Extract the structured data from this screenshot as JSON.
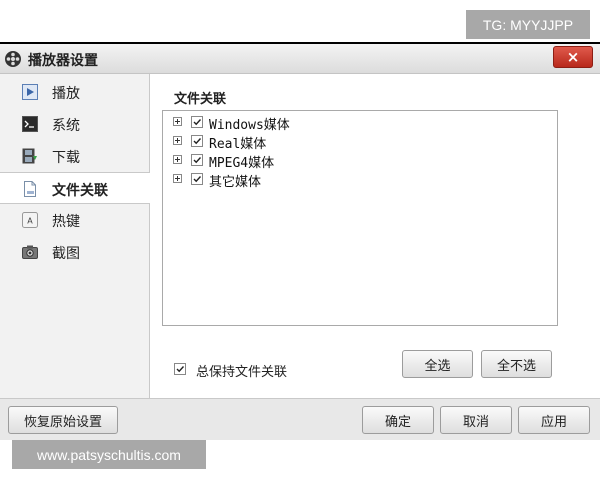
{
  "watermark_top": "TG: MYYJJPP",
  "watermark_bottom": "www.patsyschultis.com",
  "window": {
    "title": "播放器设置",
    "close_label": "×"
  },
  "sidebar": {
    "items": [
      {
        "label": "播放",
        "icon": "play-icon",
        "active": false
      },
      {
        "label": "系统",
        "icon": "terminal-icon",
        "active": false
      },
      {
        "label": "下载",
        "icon": "film-download-icon",
        "active": false
      },
      {
        "label": "文件关联",
        "icon": "document-icon",
        "active": true
      },
      {
        "label": "热键",
        "icon": "key-letter-icon",
        "active": false
      },
      {
        "label": "截图",
        "icon": "camera-icon",
        "active": false
      }
    ]
  },
  "content": {
    "section_title": "文件关联",
    "tree": [
      {
        "label": "Windows媒体",
        "checked": true
      },
      {
        "label": "Real媒体",
        "checked": true
      },
      {
        "label": "MPEG4媒体",
        "checked": true
      },
      {
        "label": "其它媒体",
        "checked": true
      }
    ],
    "always_keep": {
      "label": "总保持文件关联",
      "checked": true
    },
    "select_all": "全选",
    "select_none": "全不选"
  },
  "footer": {
    "restore": "恢复原始设置",
    "ok": "确定",
    "cancel": "取消",
    "apply": "应用"
  },
  "colors": {
    "close_button": "#c7362a",
    "active_item_bg": "#ffffff",
    "sidebar_bg": "#f2f2f2"
  }
}
